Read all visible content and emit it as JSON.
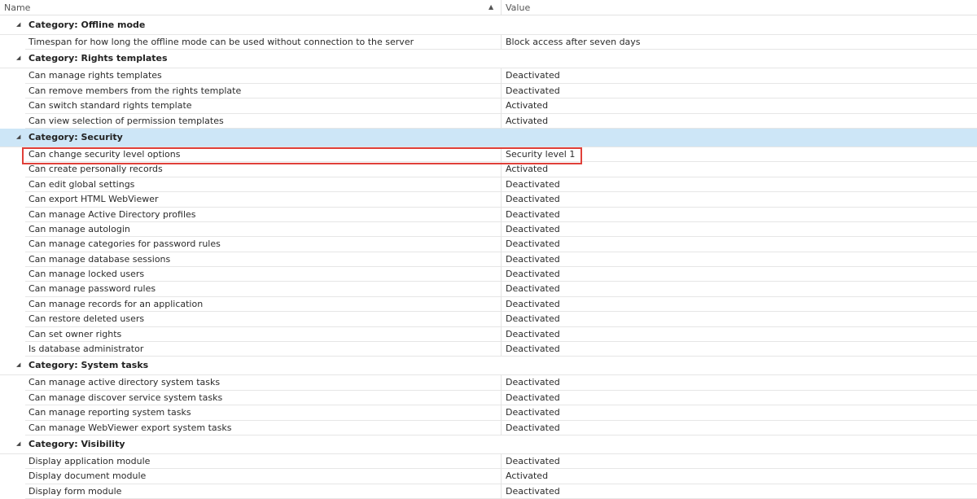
{
  "header": {
    "name": "Name",
    "value": "Value",
    "sort_icon": "sort-ascending-icon"
  },
  "categories": [
    {
      "title": "Category: Offline mode",
      "rows": [
        {
          "name": "Timespan for how long the offline mode can be used without connection to the server",
          "value": "Block access after seven days"
        }
      ]
    },
    {
      "title": "Category: Rights templates",
      "rows": [
        {
          "name": "Can manage rights templates",
          "value": "Deactivated"
        },
        {
          "name": "Can remove members from the rights template",
          "value": "Deactivated"
        },
        {
          "name": "Can switch standard rights template",
          "value": "Activated"
        },
        {
          "name": "Can view selection of permission templates",
          "value": "Activated"
        }
      ]
    },
    {
      "title": "Category: Security",
      "selected": true,
      "rows": [
        {
          "name": "Can change security level options",
          "value": "Security level 1",
          "highlighted": true
        },
        {
          "name": "Can create personally records",
          "value": "Activated"
        },
        {
          "name": "Can edit global settings",
          "value": "Deactivated"
        },
        {
          "name": "Can export HTML WebViewer",
          "value": "Deactivated"
        },
        {
          "name": "Can manage Active Directory profiles",
          "value": "Deactivated"
        },
        {
          "name": "Can manage autologin",
          "value": "Deactivated"
        },
        {
          "name": "Can manage categories for password rules",
          "value": "Deactivated"
        },
        {
          "name": "Can manage database sessions",
          "value": "Deactivated"
        },
        {
          "name": "Can manage locked users",
          "value": "Deactivated"
        },
        {
          "name": "Can manage password rules",
          "value": "Deactivated"
        },
        {
          "name": "Can manage records for an application",
          "value": "Deactivated"
        },
        {
          "name": "Can restore deleted users",
          "value": "Deactivated"
        },
        {
          "name": "Can set owner rights",
          "value": "Deactivated"
        },
        {
          "name": "Is database administrator",
          "value": "Deactivated"
        }
      ]
    },
    {
      "title": "Category: System tasks",
      "rows": [
        {
          "name": "Can manage active directory system tasks",
          "value": "Deactivated"
        },
        {
          "name": "Can manage discover service system tasks",
          "value": "Deactivated"
        },
        {
          "name": "Can manage reporting system tasks",
          "value": "Deactivated"
        },
        {
          "name": "Can manage WebViewer export system tasks",
          "value": "Deactivated"
        }
      ]
    },
    {
      "title": "Category: Visibility",
      "rows": [
        {
          "name": "Display application module",
          "value": "Deactivated"
        },
        {
          "name": "Display document module",
          "value": "Activated"
        },
        {
          "name": "Display form module",
          "value": "Deactivated"
        }
      ]
    }
  ],
  "colors": {
    "selected_row": "#cde6f7",
    "highlight_border": "#e0403a"
  }
}
